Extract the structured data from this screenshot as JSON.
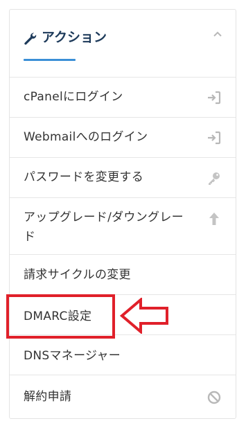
{
  "header": {
    "title": "アクション",
    "icon": "wrench-icon",
    "collapse_icon": "chevron-up-icon",
    "accent_color": "#3b8fd6",
    "title_color": "#1d3a5a"
  },
  "items": [
    {
      "label": "cPanelにログイン",
      "icon": "login-icon"
    },
    {
      "label": "Webmailへのログイン",
      "icon": "login-icon"
    },
    {
      "label": "パスワードを変更する",
      "icon": "key-icon"
    },
    {
      "label_line1": "アップグレード/ダウングレー",
      "label_line2": "ド",
      "icon": "arrow-up-icon"
    },
    {
      "label": "請求サイクルの変更",
      "icon": ""
    },
    {
      "label": "DMARC設定",
      "icon": "",
      "highlighted": true
    },
    {
      "label": "DNSマネージャー",
      "icon": ""
    },
    {
      "label": "解約申請",
      "icon": "ban-icon"
    }
  ],
  "annotation": {
    "highlight_color": "#e0202a",
    "pointer": "left-arrow-outline"
  }
}
